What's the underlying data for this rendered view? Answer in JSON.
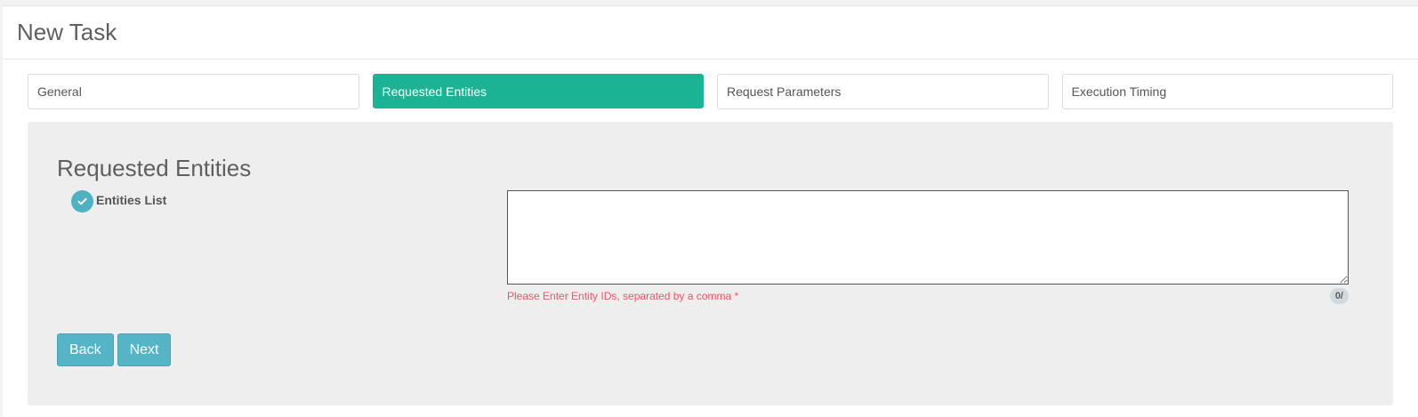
{
  "header": {
    "title": "New Task"
  },
  "steps": [
    {
      "label": "General",
      "active": false
    },
    {
      "label": "Requested Entities",
      "active": true
    },
    {
      "label": "Request Parameters",
      "active": false
    },
    {
      "label": "Execution Timing",
      "active": false
    }
  ],
  "section": {
    "title": "Requested Entities",
    "field_label": "Entities List",
    "field_value": "",
    "hint": "Please Enter Entity IDs, separated by a comma *",
    "counter": "0/"
  },
  "buttons": {
    "back_label": "Back",
    "next_label": "Next"
  },
  "colors": {
    "active_step": "#1ab394",
    "button": "#55b4c5",
    "check_icon": "#4eb1c4",
    "hint": "#ed5565",
    "content_bg": "#eeeeee"
  },
  "icons": {
    "field_status": "check-circle-icon"
  }
}
